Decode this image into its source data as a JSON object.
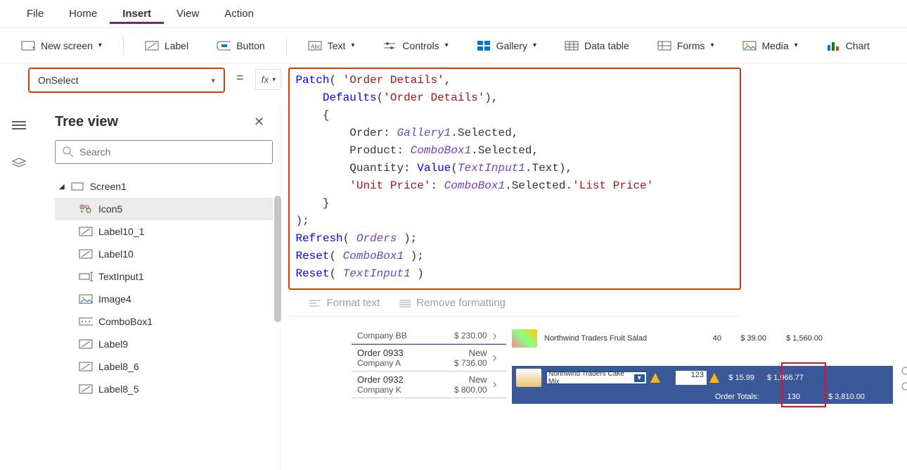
{
  "menubar": {
    "items": [
      "File",
      "Home",
      "Insert",
      "View",
      "Action"
    ],
    "active": "Insert"
  },
  "ribbon": {
    "new_screen": "New screen",
    "label": "Label",
    "button": "Button",
    "text": "Text",
    "controls": "Controls",
    "gallery": "Gallery",
    "data_table": "Data table",
    "forms": "Forms",
    "media": "Media",
    "chart": "Chart"
  },
  "formula": {
    "property": "OnSelect",
    "tokens": [
      {
        "t": "fn",
        "v": "Patch"
      },
      {
        "t": "p",
        "v": "( "
      },
      {
        "t": "str",
        "v": "'Order Details'"
      },
      {
        "t": "p",
        "v": ","
      },
      {
        "t": "nl"
      },
      {
        "t": "sp",
        "v": "    "
      },
      {
        "t": "fn",
        "v": "Defaults"
      },
      {
        "t": "p",
        "v": "("
      },
      {
        "t": "str",
        "v": "'Order Details'"
      },
      {
        "t": "p",
        "v": "),"
      },
      {
        "t": "nl"
      },
      {
        "t": "sp",
        "v": "    "
      },
      {
        "t": "p",
        "v": "{"
      },
      {
        "t": "nl"
      },
      {
        "t": "sp",
        "v": "        "
      },
      {
        "t": "p",
        "v": "Order: "
      },
      {
        "t": "ident",
        "v": "Gallery1"
      },
      {
        "t": "p",
        "v": ".Selected,"
      },
      {
        "t": "nl"
      },
      {
        "t": "sp",
        "v": "        "
      },
      {
        "t": "p",
        "v": "Product: "
      },
      {
        "t": "ident",
        "v": "ComboBox1"
      },
      {
        "t": "p",
        "v": ".Selected,"
      },
      {
        "t": "nl"
      },
      {
        "t": "sp",
        "v": "        "
      },
      {
        "t": "p",
        "v": "Quantity: "
      },
      {
        "t": "fn",
        "v": "Value"
      },
      {
        "t": "p",
        "v": "("
      },
      {
        "t": "ident",
        "v": "TextInput1"
      },
      {
        "t": "p",
        "v": ".Text),"
      },
      {
        "t": "nl"
      },
      {
        "t": "sp",
        "v": "        "
      },
      {
        "t": "str",
        "v": "'Unit Price'"
      },
      {
        "t": "p",
        "v": ": "
      },
      {
        "t": "ident",
        "v": "ComboBox1"
      },
      {
        "t": "p",
        "v": ".Selected."
      },
      {
        "t": "str",
        "v": "'List Price'"
      },
      {
        "t": "nl"
      },
      {
        "t": "sp",
        "v": "    "
      },
      {
        "t": "p",
        "v": "}"
      },
      {
        "t": "nl"
      },
      {
        "t": "p",
        "v": ");"
      },
      {
        "t": "nl"
      },
      {
        "t": "fn",
        "v": "Refresh"
      },
      {
        "t": "p",
        "v": "( "
      },
      {
        "t": "ident",
        "v": "Orders"
      },
      {
        "t": "p",
        "v": " );"
      },
      {
        "t": "nl"
      },
      {
        "t": "fn",
        "v": "Reset"
      },
      {
        "t": "p",
        "v": "( "
      },
      {
        "t": "ident",
        "v": "ComboBox1"
      },
      {
        "t": "p",
        "v": " );"
      },
      {
        "t": "nl"
      },
      {
        "t": "fn",
        "v": "Reset"
      },
      {
        "t": "p",
        "v": "( "
      },
      {
        "t": "ident",
        "v": "TextInput1"
      },
      {
        "t": "p",
        "v": " )"
      }
    ],
    "format_text": "Format text",
    "remove_formatting": "Remove formatting"
  },
  "tree": {
    "title": "Tree view",
    "search_placeholder": "Search",
    "root": "Screen1",
    "items": [
      {
        "type": "icon",
        "label": "Icon5",
        "selected": true
      },
      {
        "type": "label",
        "label": "Label10_1"
      },
      {
        "type": "label",
        "label": "Label10"
      },
      {
        "type": "textinput",
        "label": "TextInput1"
      },
      {
        "type": "image",
        "label": "Image4"
      },
      {
        "type": "combo",
        "label": "ComboBox1"
      },
      {
        "type": "label",
        "label": "Label9"
      },
      {
        "type": "label",
        "label": "Label8_6"
      },
      {
        "type": "label",
        "label": "Label8_5"
      }
    ]
  },
  "canvas": {
    "orders": [
      {
        "title": "",
        "company": "Company BB",
        "status": "",
        "amount": "$ 230.00"
      },
      {
        "title": "Order 0933",
        "company": "Company A",
        "status": "New",
        "amount": "$ 736.00"
      },
      {
        "title": "Order 0932",
        "company": "Company K",
        "status": "New",
        "amount": "$ 800.00"
      }
    ],
    "detail_row": {
      "name": "Northwind Traders Fruit Salad",
      "qty": "40",
      "unit": "$ 39.00",
      "total": "$ 1,560.00"
    },
    "edit_row": {
      "combo": "Northwind Traders Cake Mix",
      "qty": "123",
      "unit": "$ 15.99",
      "total": "$ 1,966.77"
    },
    "totals": {
      "label": "Order Totals:",
      "qty": "130",
      "amount": "$ 3,810.00"
    }
  }
}
